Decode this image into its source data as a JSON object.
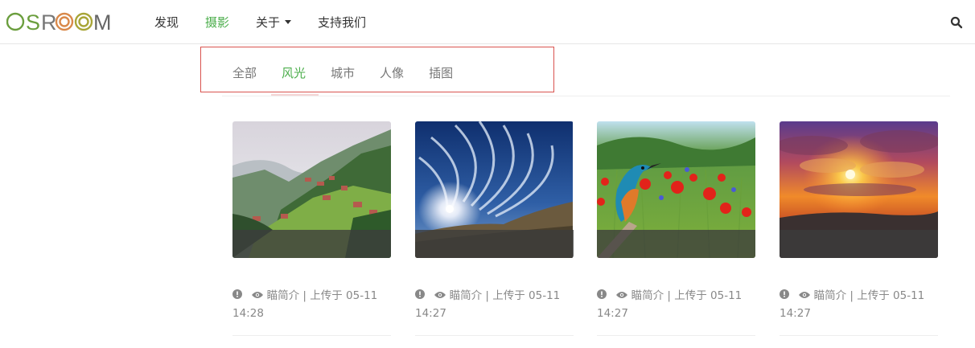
{
  "brand": {
    "logo_text": "OSROOM",
    "colors": {
      "green": "#6b9e3e",
      "orange": "#d9894a",
      "olive": "#a8a537",
      "gray": "#666666"
    }
  },
  "nav": {
    "items": [
      {
        "label": "发现"
      },
      {
        "label": "摄影",
        "active": true
      },
      {
        "label": "关于",
        "dropdown": true
      },
      {
        "label": "支持我们"
      }
    ],
    "search_icon": "search-icon"
  },
  "categories": {
    "items": [
      {
        "label": "全部"
      },
      {
        "label": "风光",
        "active": true
      },
      {
        "label": "城市"
      },
      {
        "label": "人像"
      },
      {
        "label": "插图"
      }
    ]
  },
  "photos": [
    {
      "image": "mountain-village",
      "title": "瞄简介",
      "sep": "|",
      "uploaded": "上传于 05-11",
      "time": "14:28"
    },
    {
      "image": "sun-sky-clouds",
      "title": "瞄简介",
      "sep": "|",
      "uploaded": "上传于 05-11",
      "time": "14:27"
    },
    {
      "image": "kingfisher-poppies",
      "title": "瞄简介",
      "sep": "|",
      "uploaded": "上传于 05-11",
      "time": "14:27"
    },
    {
      "image": "sunset-clouds",
      "title": "瞄简介",
      "sep": "|",
      "uploaded": "上传于 05-11",
      "time": "14:27"
    }
  ],
  "accent": "#4cae4c"
}
